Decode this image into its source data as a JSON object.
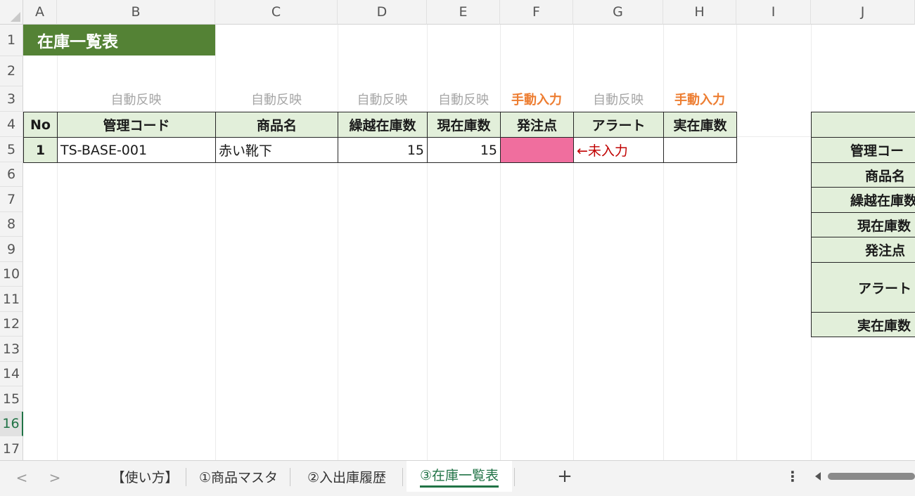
{
  "columns": [
    "A",
    "B",
    "C",
    "D",
    "E",
    "F",
    "G",
    "H",
    "I",
    "J"
  ],
  "rows": [
    "1",
    "2",
    "3",
    "4",
    "5",
    "6",
    "7",
    "8",
    "9",
    "10",
    "11",
    "12",
    "13",
    "14",
    "15",
    "16",
    "17"
  ],
  "title": "在庫一覧表",
  "notes": {
    "B": "自動反映",
    "C": "自動反映",
    "D": "自動反映",
    "E": "自動反映",
    "F": "手動入力",
    "G": "自動反映",
    "H": "手動入力"
  },
  "table": {
    "headers": [
      "No",
      "管理コード",
      "商品名",
      "繰越在庫数",
      "現在庫数",
      "発注点",
      "アラート",
      "実在庫数"
    ],
    "rows": [
      {
        "no": "1",
        "code": "TS-BASE-001",
        "name": "赤い靴下",
        "carry": "15",
        "current": "15",
        "order_point": "",
        "alert": "←未入力",
        "actual": ""
      }
    ]
  },
  "side_panel": {
    "labels": [
      "管理コー",
      "商品名",
      "繰越在庫数",
      "現在庫数",
      "発注点",
      "アラート",
      "実在庫数"
    ]
  },
  "tabs": [
    "【使い方】",
    "①商品マスタ",
    "②入出庫履歴",
    "③在庫一覧表"
  ],
  "active_tab": "③在庫一覧表",
  "bottom": {
    "prev": "<",
    "next": ">",
    "add": "+",
    "more": "⋮"
  },
  "colors": {
    "title_bg": "#548235",
    "header_bg": "#e2efda",
    "manual": "#ed7d31",
    "auto": "#a6a6a6",
    "alert": "#c00000",
    "highlight": "#f06e9e",
    "accent": "#217346"
  }
}
